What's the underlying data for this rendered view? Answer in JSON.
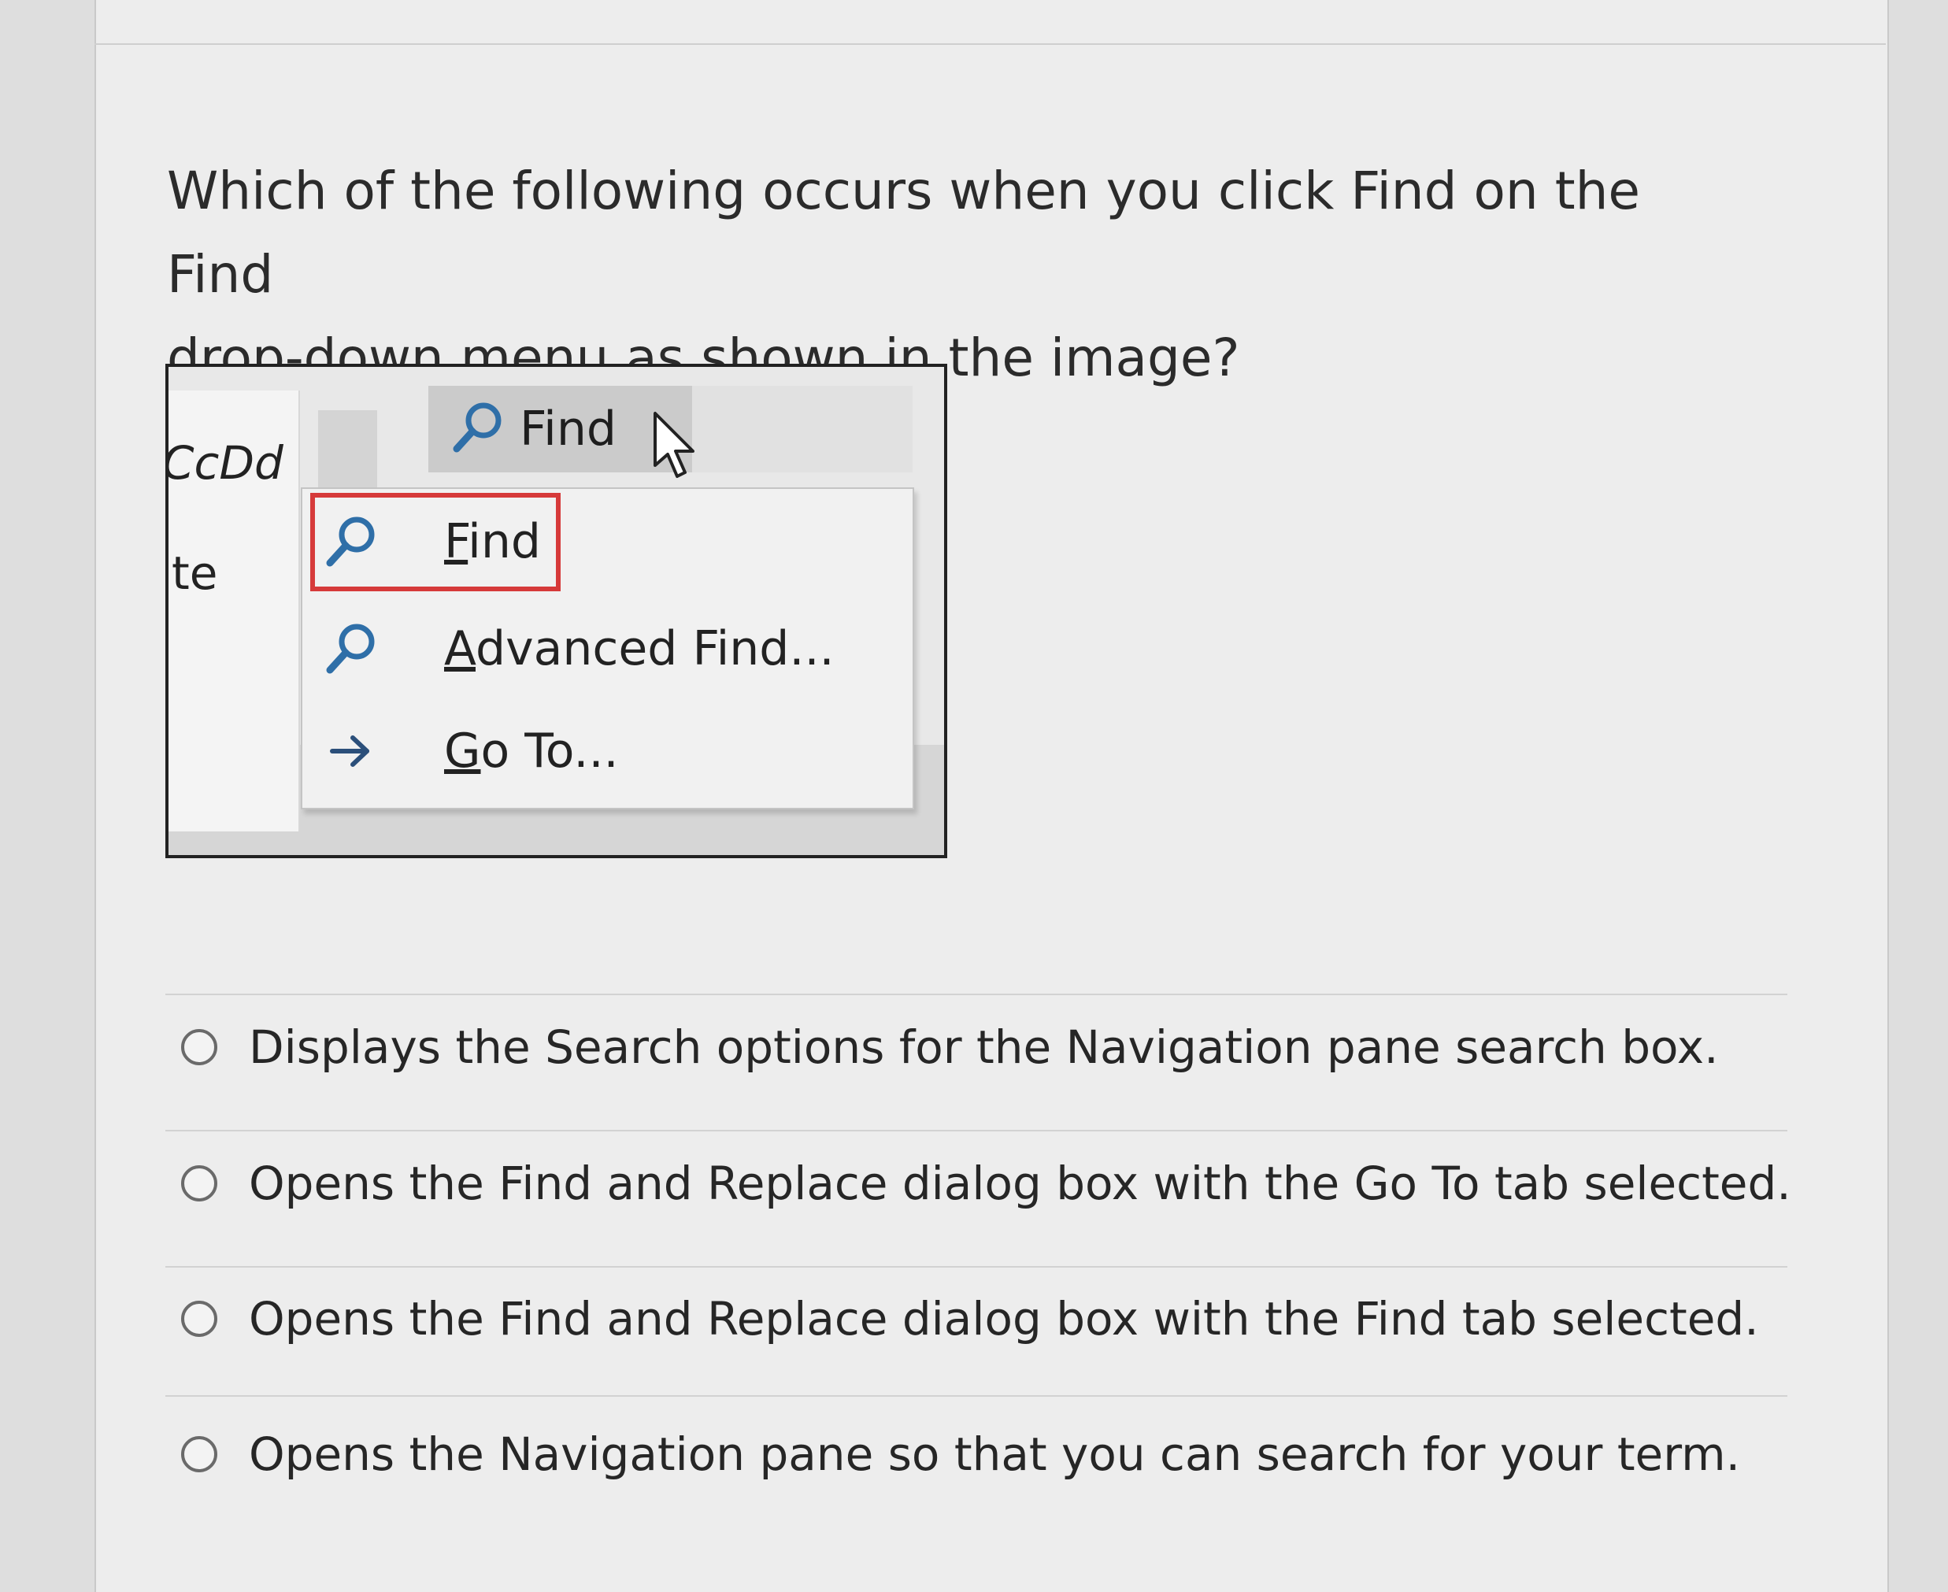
{
  "question": {
    "line1": "Which of the following occurs when you click Find on the Find",
    "line2": "drop-down menu as shown in the image?"
  },
  "screenshot": {
    "left_fragment_top": "CcDd",
    "left_fragment_bottom": "te",
    "find_button_label": "Find",
    "menu_items": [
      {
        "first": "F",
        "rest": "ind",
        "icon": "search-icon"
      },
      {
        "first": "A",
        "rest": "dvanced Find...",
        "icon": "search-icon"
      },
      {
        "first": "G",
        "rest": "o To...",
        "icon": "arrow-right-icon"
      }
    ],
    "highlight_color": "#d63a3a"
  },
  "options": [
    {
      "label": "Displays the Search options for the Navigation pane search box."
    },
    {
      "label": "Opens the Find and Replace dialog box with the Go To tab selected."
    },
    {
      "label": "Opens the Find and Replace dialog box with the Find tab selected."
    },
    {
      "label": "Opens the Navigation pane so that you can search for your term."
    }
  ]
}
